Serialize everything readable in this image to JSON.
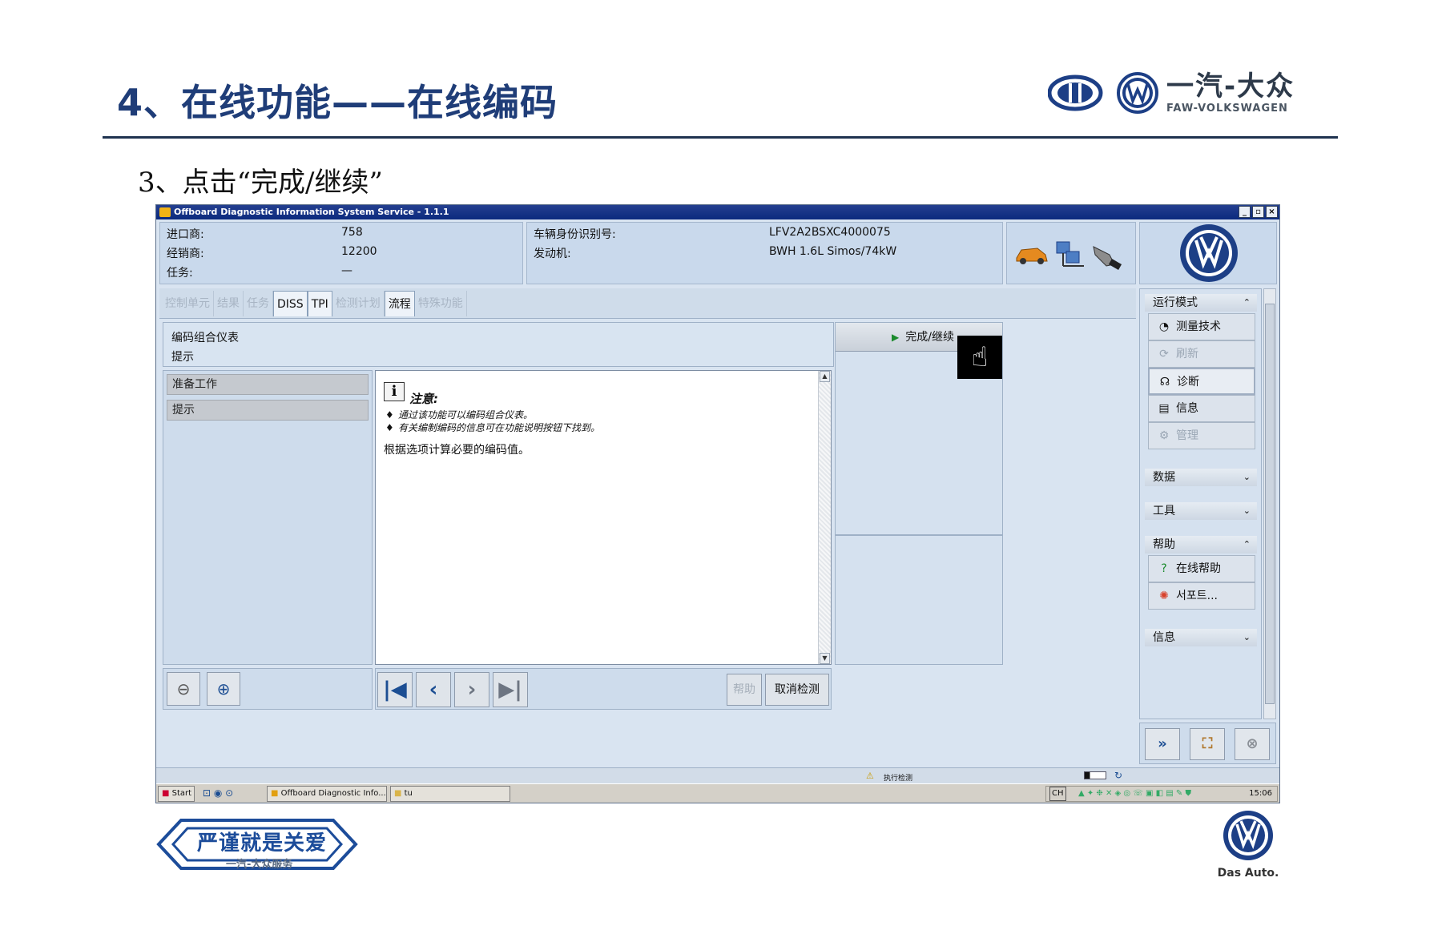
{
  "slide": {
    "title": "4、在线功能——在线编码",
    "brand_cn": "一汽-大众",
    "brand_en": "FAW-VOLKSWAGEN",
    "step": "3、点击“完成/继续”",
    "footer_slogan": "严谨就是关爱",
    "footer_sub": "一汽-大众服务",
    "das_auto": "Das Auto."
  },
  "window": {
    "title": "Offboard Diagnostic Information System Service - 1.1.1",
    "controls": [
      "_",
      "▫",
      "×"
    ]
  },
  "info": {
    "importer_label": "进口商:",
    "importer_value": "758",
    "dealer_label": "经销商:",
    "dealer_value": "12200",
    "task_label": "任务:",
    "task_value": "—",
    "vin_label": "车辆身份识别号:",
    "vin_value": "LFV2A2BSXC4000075",
    "engine_label": "发动机:",
    "engine_value": "BWH 1.6L Simos/74kW"
  },
  "tabs": [
    "控制单元",
    "结果",
    "任务",
    "DISS",
    "TPI",
    "检测计划",
    "流程",
    "特殊功能"
  ],
  "header": {
    "line1": "编码组合仪表",
    "line2": "提示"
  },
  "left_list": [
    "准备工作",
    "提示"
  ],
  "content": {
    "note_icon": "i",
    "note_title": "注意:",
    "bullets": [
      "通过该功能可以编码组合仪表。",
      "有关编制编码的信息可在功能说明按钮下找到。"
    ],
    "body": "根据选项计算必要的编码值。"
  },
  "finish_button": "完成/继续",
  "sidebar": {
    "mode_section": "运行模式",
    "items": [
      {
        "label": "测量技术",
        "icon": "gauge-icon",
        "glyph": "◔"
      },
      {
        "label": "刷新",
        "icon": "refresh-icon",
        "glyph": "⟳"
      },
      {
        "label": "诊断",
        "icon": "stethoscope-icon",
        "glyph": "☊"
      },
      {
        "label": "信息",
        "icon": "info-books-icon",
        "glyph": "▤"
      },
      {
        "label": "管理",
        "icon": "admin-gear-icon",
        "glyph": "⚙"
      }
    ],
    "data_section": "数据",
    "tools_section": "工具",
    "help_section": "帮助",
    "help_items": [
      {
        "label": "在线帮助",
        "icon": "help-icon",
        "glyph": "?"
      },
      {
        "label": "서포트...",
        "icon": "lifebuoy-icon",
        "glyph": "✺"
      }
    ],
    "info_section": "信息"
  },
  "bottom": {
    "help": "帮助",
    "cancel": "取消检测"
  },
  "status": {
    "text": "执行检测"
  },
  "taskbar": {
    "start": "Start",
    "task1": "Offboard Diagnostic Info...",
    "task2": "tu",
    "lang": "CH",
    "clock": "15:06"
  }
}
